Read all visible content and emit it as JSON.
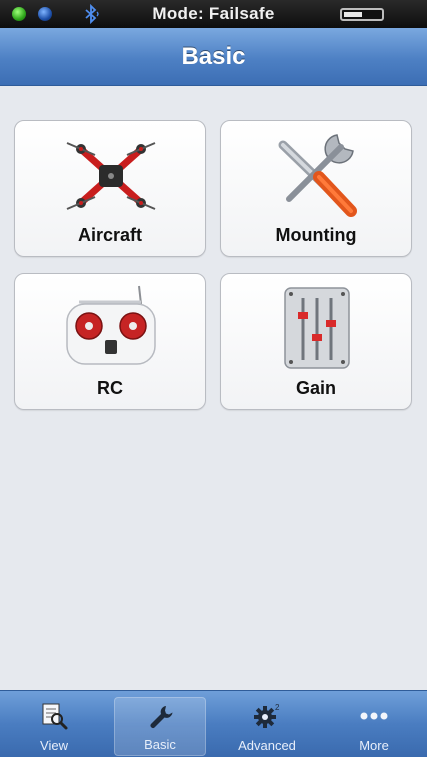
{
  "status_bar": {
    "mode_text": "Mode: Failsafe",
    "indicators": [
      "green-led",
      "blue-led",
      "bluetooth-icon",
      "battery-icon"
    ]
  },
  "nav": {
    "title": "Basic"
  },
  "tiles": [
    {
      "label": "Aircraft",
      "icon": "aircraft-icon"
    },
    {
      "label": "Mounting",
      "icon": "mounting-icon"
    },
    {
      "label": "RC",
      "icon": "rc-icon"
    },
    {
      "label": "Gain",
      "icon": "gain-icon"
    }
  ],
  "tabbar": {
    "tabs": [
      {
        "label": "View",
        "icon": "view-icon",
        "active": false
      },
      {
        "label": "Basic",
        "icon": "wrench-icon",
        "active": true
      },
      {
        "label": "Advanced",
        "icon": "gear-icon",
        "active": false
      },
      {
        "label": "More",
        "icon": "more-icon",
        "active": false
      }
    ]
  },
  "colors": {
    "nav_blue": "#4d80c4",
    "background": "#e6e9ee",
    "drone_red": "#d42020"
  }
}
